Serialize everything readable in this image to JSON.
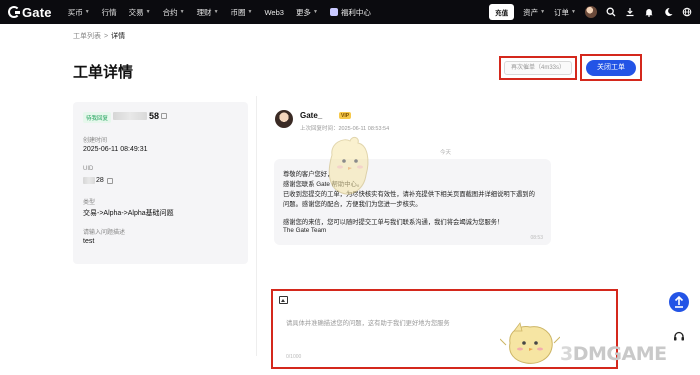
{
  "brand": {
    "name": "Gate"
  },
  "nav": {
    "items": [
      {
        "label": "买币",
        "caret": true
      },
      {
        "label": "行情",
        "caret": false
      },
      {
        "label": "交易",
        "caret": true
      },
      {
        "label": "合约",
        "caret": true
      },
      {
        "label": "理财",
        "caret": true
      },
      {
        "label": "币圈",
        "caret": true
      },
      {
        "label": "Web3",
        "caret": false
      },
      {
        "label": "更多",
        "caret": true
      }
    ],
    "gift": "福利中心"
  },
  "topbar_right": {
    "deposit": "充值",
    "assets": "资产",
    "orders": "订单"
  },
  "breadcrumb": {
    "parent": "工单列表",
    "separator": ">",
    "current": "详情"
  },
  "page": {
    "title": "工单详情"
  },
  "actions": {
    "reply": "再次催单（4m33s）",
    "close": "关闭工单"
  },
  "ticket": {
    "status": "待我回复",
    "number_suffix": "58",
    "created_label": "创建时间",
    "created_value": "2025-06-11 08:49:31",
    "uid_label": "UID",
    "uid_suffix": "28",
    "type_label": "类型",
    "type_value": "交易->Alpha->Alpha基础问题",
    "desc_label": "请输入问题描述",
    "desc_value": "test"
  },
  "conversation": {
    "agent_name": "Gate_",
    "agent_badge": "VIP",
    "agent_time": "上次回复时间：2025-06-11 08:53:54",
    "date_divider": "今天",
    "message_lines": [
      "尊敬的客户您好，",
      "感谢您联系 Gate 帮助中心。",
      "已收到您提交的工单，为尽快核实有效性，请补充提供下相关页面截图并详细说明下遇到的",
      "问题。感谢您的配合，方便我们为您进一步核实。",
      "",
      "感谢您的来信，您可以随时提交工单与我们联系沟通，我们将会竭诚为您服务！",
      "The Gate Team"
    ],
    "message_time": "08:53"
  },
  "composer": {
    "placeholder": "请具体并准确描述您的问题，这有助于我们更好地为您服务",
    "counter": "0/1000"
  },
  "watermark": {
    "prefix": "3",
    "text": "DMGAME"
  },
  "colors": {
    "accent": "#2354e6",
    "highlight": "#d4281c",
    "status_green": "#1fa25a",
    "topbar": "#0b0b0f"
  }
}
